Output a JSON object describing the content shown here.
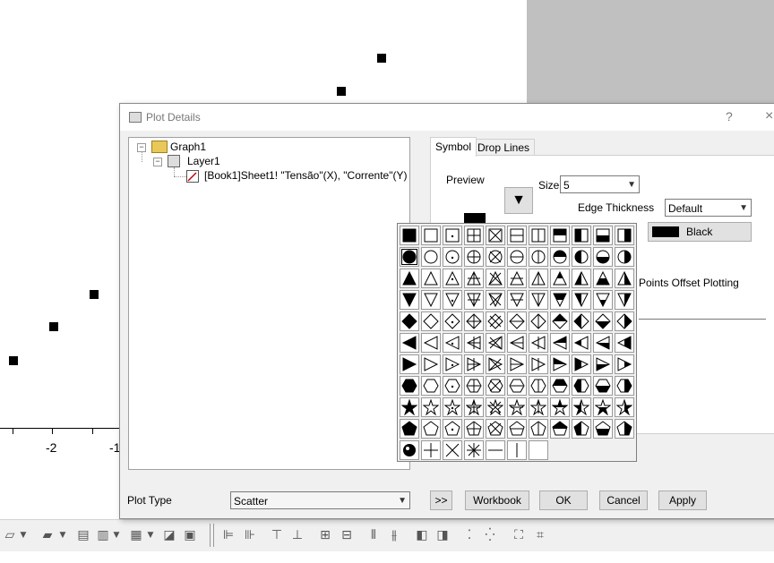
{
  "graph": {
    "tick_labels": [
      "-2",
      "-1"
    ],
    "marker_color": "#000000"
  },
  "dialog": {
    "title": "Plot Details",
    "help": "?",
    "close": "×"
  },
  "tree": {
    "root": "Graph1",
    "layer": "Layer1",
    "dataset": "[Book1]Sheet1! \"Tensão\"(X), \"Corrente\"(Y)"
  },
  "tabs": [
    {
      "label": "Symbol",
      "active": true
    },
    {
      "label": "Drop Lines",
      "active": false
    }
  ],
  "symbol_tab": {
    "preview_label": "Preview",
    "size_label": "Size",
    "size_value": "5",
    "edge_thickness_label": "Edge Thickness",
    "edge_thickness_value": "Default",
    "color_value": "Black",
    "points_offset_label": "Points Offset Plotting"
  },
  "plot_type": {
    "label": "Plot Type",
    "value": "Scatter"
  },
  "buttons": {
    "more": ">>",
    "workbook": "Workbook",
    "ok": "OK",
    "cancel": "Cancel",
    "apply": "Apply"
  },
  "symbol_grid": {
    "rows": [
      "square",
      "circle",
      "triangle-up",
      "triangle-down",
      "diamond",
      "triangle-left",
      "triangle-right",
      "hexagon",
      "star",
      "pentagon",
      "misc"
    ],
    "selected": "filled-circle"
  }
}
